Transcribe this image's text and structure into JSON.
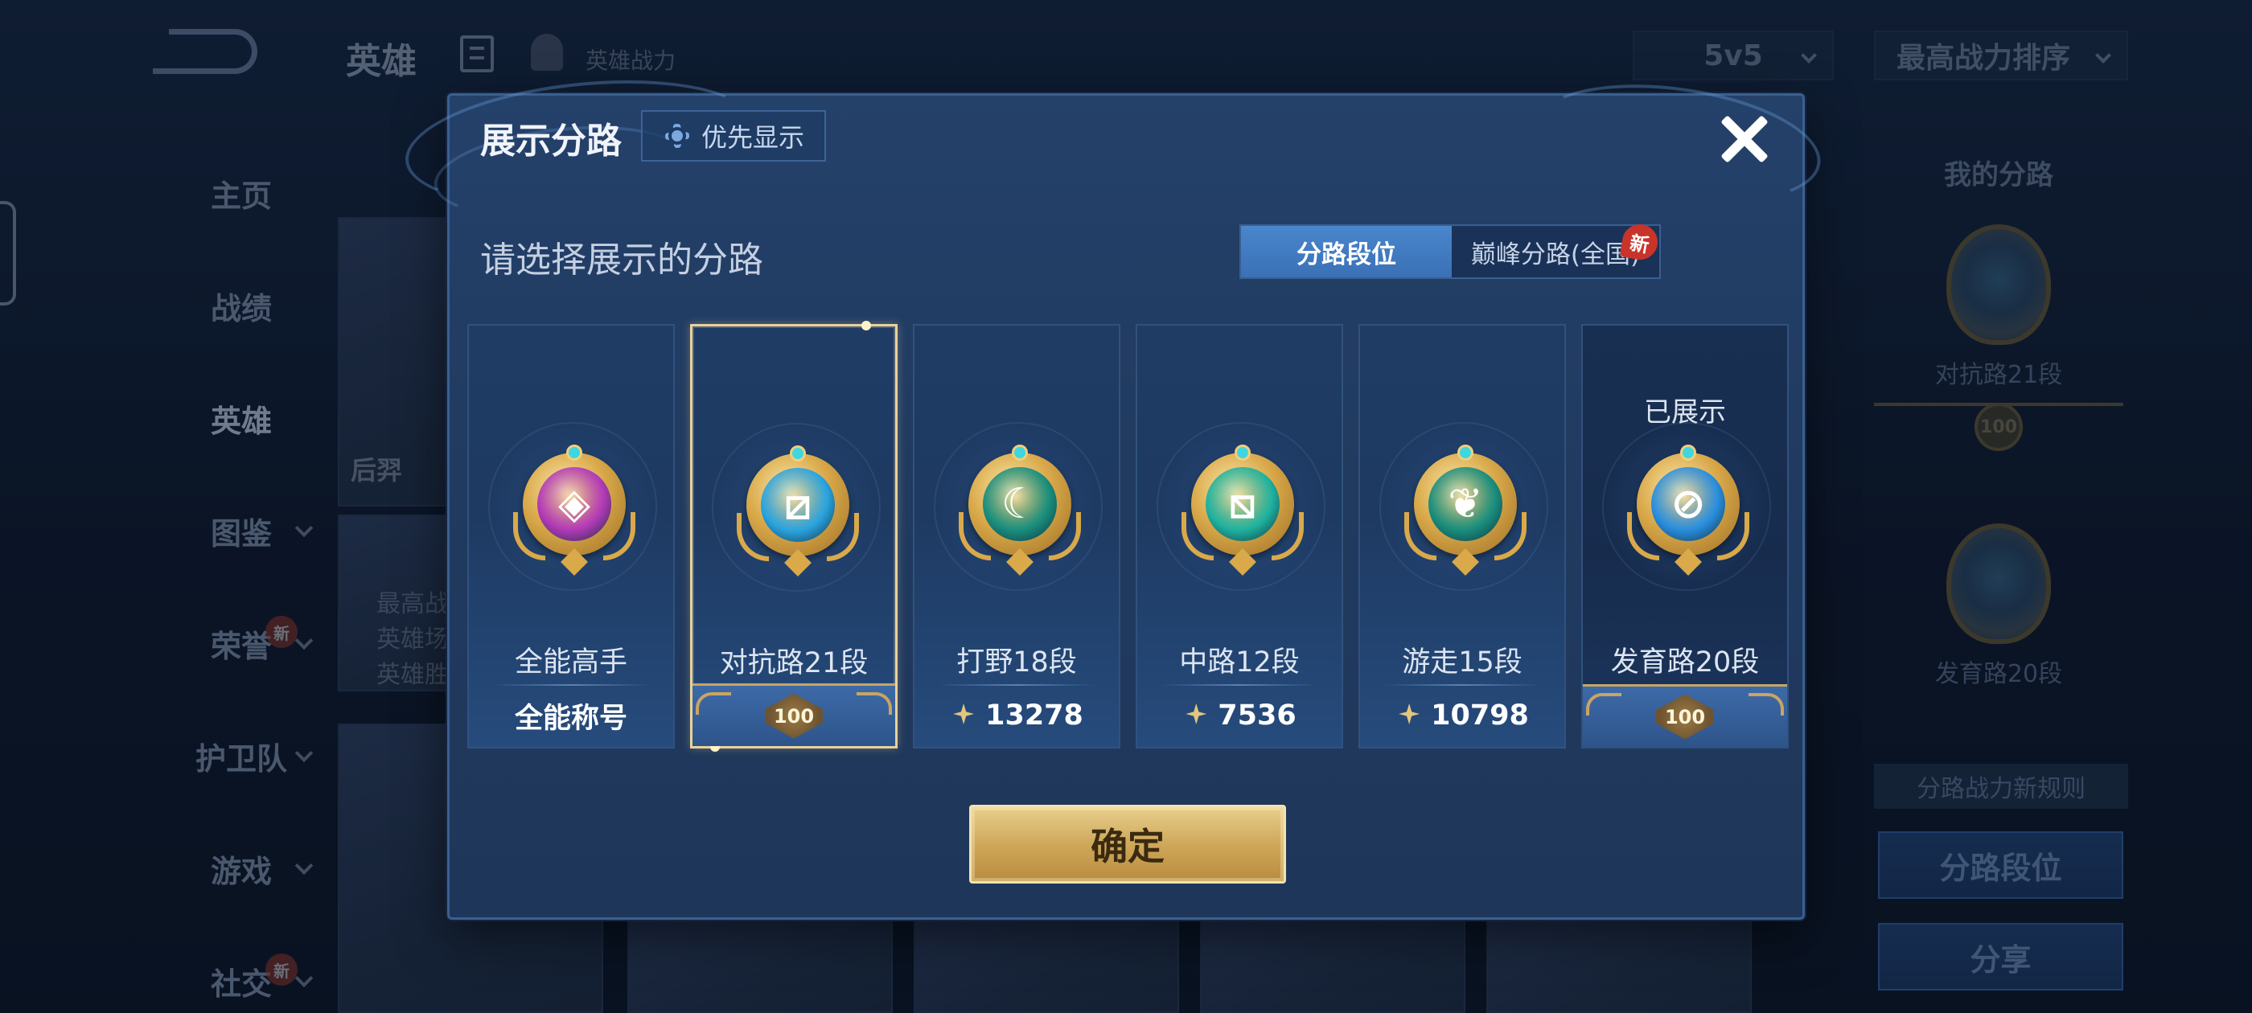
{
  "background": {
    "top_title": "英雄",
    "top_subtitle": "英雄战力",
    "mode_select": "5v5",
    "sort_select": "最高战力排序",
    "nav": [
      {
        "label": "主页",
        "has_chevron": false
      },
      {
        "label": "战绩",
        "has_chevron": false
      },
      {
        "label": "英雄",
        "has_chevron": false,
        "active": true
      },
      {
        "label": "图鉴",
        "has_chevron": true
      },
      {
        "label": "荣誉",
        "has_chevron": true,
        "new": "新"
      },
      {
        "label": "护卫队",
        "has_chevron": true
      },
      {
        "label": "游戏",
        "has_chevron": true
      },
      {
        "label": "社交",
        "has_chevron": true,
        "new": "新"
      }
    ],
    "hero_card_name": "后羿",
    "hero_stats": [
      "最高战",
      "英雄场",
      "英雄胜"
    ],
    "right_panel": {
      "title": "我的分路",
      "lane1_label": "对抗路21段",
      "lane1_badge": "100",
      "lane2_label": "发育路20段",
      "rule_link": "分路战力新规则",
      "lane_rank_button": "分路段位",
      "share_button": "分享"
    }
  },
  "modal": {
    "title": "展示分路",
    "priority_button": "优先显示",
    "subtitle": "请选择展示的分路",
    "tabs": [
      {
        "label": "分路段位",
        "active": true
      },
      {
        "label": "巅峰分路(全国)",
        "active": false,
        "badge": "新"
      }
    ],
    "cards": [
      {
        "rank": "全能高手",
        "footer": "全能称号",
        "footer_type": "title",
        "emblem_color": "#b33ab8",
        "emblem_glyph": "◈",
        "selected": false,
        "shown": false
      },
      {
        "rank": "对抗路21段",
        "footer": "100",
        "footer_type": "badge",
        "emblem_color": "#2aa4e0",
        "emblem_glyph": "⧄",
        "selected": true,
        "shown": false
      },
      {
        "rank": "打野18段",
        "footer": "13278",
        "footer_type": "power",
        "emblem_color": "#1a8f7e",
        "emblem_glyph": "☾",
        "selected": false,
        "shown": false
      },
      {
        "rank": "中路12段",
        "footer": "7536",
        "footer_type": "power",
        "emblem_color": "#1fb3a0",
        "emblem_glyph": "⧅",
        "selected": false,
        "shown": false
      },
      {
        "rank": "游走15段",
        "footer": "10798",
        "footer_type": "power",
        "emblem_color": "#1a8f7e",
        "emblem_glyph": "❦",
        "selected": false,
        "shown": false
      },
      {
        "rank": "发育路20段",
        "footer": "100",
        "footer_type": "badge",
        "emblem_color": "#2a8fe0",
        "emblem_glyph": "⊘",
        "selected": false,
        "shown": true,
        "shown_label": "已展示"
      }
    ],
    "confirm_button": "确定"
  },
  "icons": {
    "close": "close-icon",
    "gear": "gear-icon",
    "power": "power-icon",
    "back": "back-arrow-icon"
  }
}
